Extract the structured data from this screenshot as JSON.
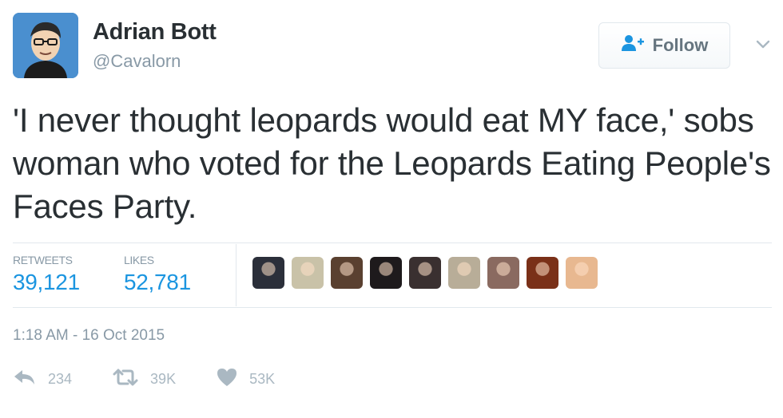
{
  "user": {
    "name": "Adrian Bott",
    "handle": "@Cavalorn"
  },
  "follow_button": {
    "label": "Follow"
  },
  "tweet": {
    "text": "'I never thought leopards would eat MY face,' sobs woman who voted for the Leopards Eating People's Faces Party."
  },
  "stats": {
    "retweets_label": "RETWEETS",
    "retweets_value": "39,121",
    "likes_label": "LIKES",
    "likes_value": "52,781"
  },
  "liker_avatar_colors": [
    "#2b2f3a",
    "#c9c2a8",
    "#5a4030",
    "#1e1a1c",
    "#3a3030",
    "#b8ad98",
    "#8a6a60",
    "#7a3018",
    "#e8b890"
  ],
  "timestamp": "1:18 AM - 16 Oct 2015",
  "actions": {
    "reply_count": "234",
    "retweet_count": "39K",
    "like_count": "53K"
  },
  "colors": {
    "link_blue": "#1b95e0",
    "muted_gray": "#8899a6",
    "icon_gray": "#aab8c2",
    "text": "#292f33"
  }
}
